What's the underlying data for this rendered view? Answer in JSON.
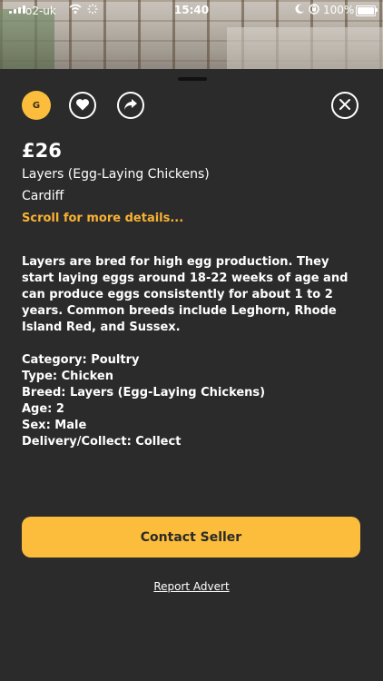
{
  "status_bar": {
    "carrier": "o2-uk",
    "time": "15:40",
    "battery": "100%"
  },
  "listing": {
    "avatar_initial": "G",
    "price": "£26",
    "title": "Layers (Egg-Laying Chickens)",
    "location": "Cardiff",
    "scroll_hint": "Scroll for more details...",
    "description": "Layers are bred for high egg production. They start laying eggs around 18-22 weeks of age and can produce eggs consistently for about 1 to 2 years. Common breeds include Leghorn, Rhode Island Red, and Sussex.",
    "details": [
      "Category: Poultry",
      "Type: Chicken",
      "Breed: Layers (Egg-Laying Chickens)",
      "Age: 2",
      "Sex: Male",
      "Delivery/Collect: Collect"
    ]
  },
  "actions": {
    "contact_label": "Contact Seller",
    "report_label": "Report Advert"
  },
  "colors": {
    "accent": "#fbbd3b",
    "background": "#2b2b2b"
  },
  "icons": {
    "favorite": "heart-icon",
    "share": "share-icon",
    "close": "close-icon"
  }
}
